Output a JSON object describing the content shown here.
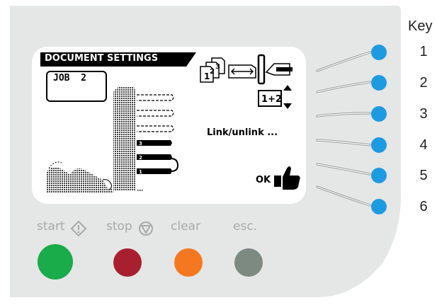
{
  "lcd": {
    "title": "DOCUMENT SETTINGS",
    "job_label": "JOB  2",
    "fold_label": "1+2",
    "link_label": "Link/unlink ...",
    "ok_label": "OK",
    "envelope_numbers": [
      "3",
      "2",
      "1"
    ],
    "icons": [
      "document-stack-icon",
      "length-arrow-icon",
      "insert-envelope-icon",
      "up-arrow-icon",
      "down-arrow-icon",
      "thumbs-up-icon"
    ]
  },
  "key": {
    "title": "Key",
    "buttons": [
      "1",
      "2",
      "3",
      "4",
      "5",
      "6"
    ]
  },
  "controls": {
    "start_label": "start",
    "stop_label": "stop",
    "clear_label": "clear",
    "esc_label": "esc."
  },
  "colors": {
    "panel": "#e5e6e6",
    "key_button": "#1e9be0",
    "start": "#1aab4b",
    "stop": "#a8202f",
    "clear": "#f57820",
    "esc": "#7d8a81",
    "label_gray": "#a7a9aa"
  }
}
